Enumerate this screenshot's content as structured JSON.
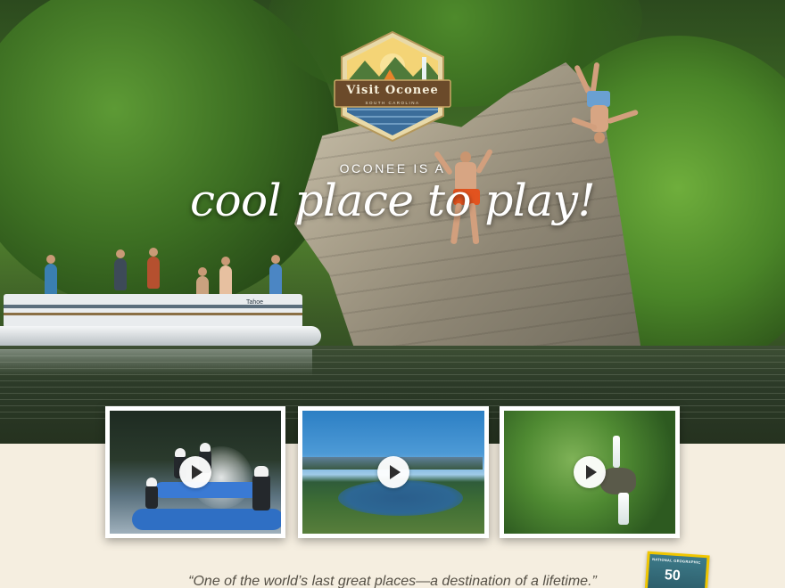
{
  "logo": {
    "title": "Visit Oconee",
    "subtitle": "SOUTH CAROLINA"
  },
  "hero": {
    "kicker": "OCONEE IS A",
    "headline": "cool place to play!",
    "boat_label": "Tahoe"
  },
  "videos": [
    {
      "label": "Whitewater rafting video",
      "icon": "play-icon"
    },
    {
      "label": "Lake aerial video",
      "icon": "play-icon"
    },
    {
      "label": "Waterfall video",
      "icon": "play-icon"
    }
  ],
  "quote": {
    "text": "“One of the world’s last great places—a destination of a lifetime.”"
  },
  "badge": {
    "brand": "NATIONAL GEOGRAPHIC",
    "number": "50"
  },
  "colors": {
    "background": "#f5eee0",
    "accent": "#f0c600",
    "text": "#555046"
  }
}
